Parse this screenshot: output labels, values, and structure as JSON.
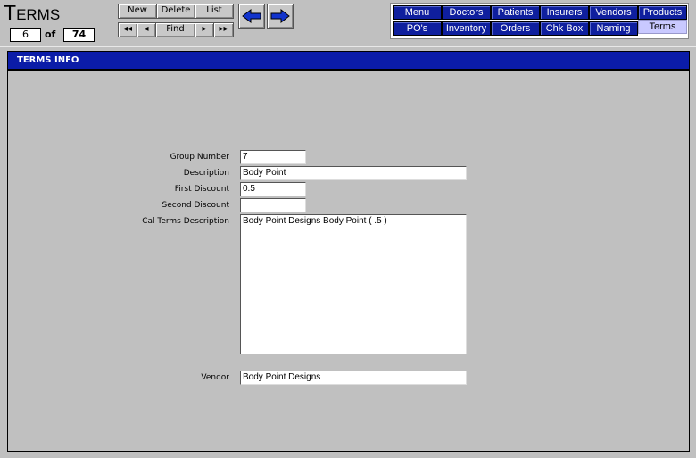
{
  "title": {
    "first": "T",
    "rest": "ERMS"
  },
  "record": {
    "current": "6",
    "of_label": "of",
    "total": "74"
  },
  "toolbar": {
    "new_label": "New",
    "delete_label": "Delete",
    "list_label": "List",
    "first_label": "◂◂",
    "prev_label": "◂",
    "find_label": "Find",
    "next_label": "▸",
    "last_label": "▸▸"
  },
  "arrows": {
    "back_icon": "arrow-left-icon",
    "forward_icon": "arrow-right-icon"
  },
  "nav": {
    "row1": [
      "Menu",
      "Doctors",
      "Patients",
      "Insurers",
      "Vendors",
      "Products"
    ],
    "row2": [
      "PO's",
      "Inventory",
      "Orders",
      "Chk Box",
      "Naming",
      "Terms"
    ],
    "active": "Terms"
  },
  "panel": {
    "header": "TERMS INFO"
  },
  "form": {
    "group_number": {
      "label": "Group Number",
      "value": "7"
    },
    "description": {
      "label": "Description",
      "value": "Body Point"
    },
    "first_discount": {
      "label": "First Discount",
      "value": "0.5"
    },
    "second_discount": {
      "label": "Second Discount",
      "value": ""
    },
    "cal_terms_description": {
      "label": "Cal Terms Description",
      "value": "Body Point Designs Body Point ( .5 )"
    },
    "vendor": {
      "label": "Vendor",
      "value": "Body Point Designs"
    }
  },
  "colors": {
    "nav_blue": "#0f1f9e",
    "header_blue": "#0b1ca8",
    "active_tab": "#c9c9ff",
    "background": "#c0c0c0"
  }
}
